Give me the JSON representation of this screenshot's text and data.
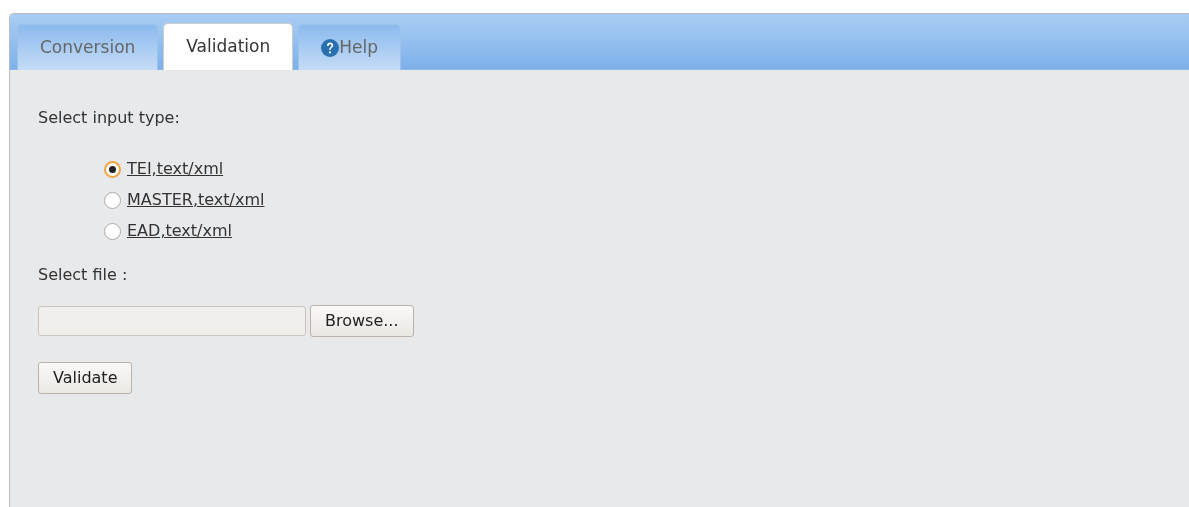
{
  "tabs": [
    {
      "label": "Conversion",
      "selected": false,
      "kind": "text"
    },
    {
      "label": "Validation",
      "selected": true,
      "kind": "text"
    },
    {
      "label": "Help",
      "selected": false,
      "kind": "help"
    }
  ],
  "input_type": {
    "label": "Select input type:",
    "options": [
      {
        "label": "TEI,text/xml",
        "selected": true
      },
      {
        "label": "MASTER,text/xml",
        "selected": false
      },
      {
        "label": "EAD,text/xml",
        "selected": false
      }
    ]
  },
  "file": {
    "label": "Select file :",
    "browse_button": "Browse..."
  },
  "validate_button": "Validate"
}
